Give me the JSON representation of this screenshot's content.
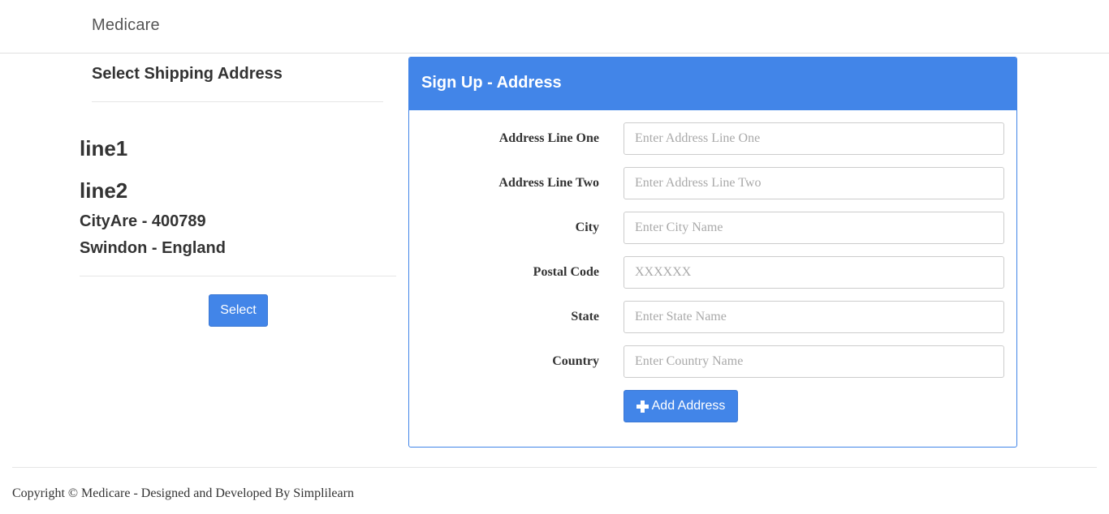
{
  "navbar": {
    "brand": "Medicare"
  },
  "shipping": {
    "heading": "Select Shipping Address",
    "address": {
      "line1": "line1",
      "line2": "line2",
      "city_postal": "CityAre - 400789",
      "state_country": "Swindon - England"
    },
    "select_label": "Select"
  },
  "form": {
    "title": "Sign Up - Address",
    "fields": [
      {
        "label": "Address Line One",
        "placeholder": "Enter Address Line One",
        "value": ""
      },
      {
        "label": "Address Line Two",
        "placeholder": "Enter Address Line Two",
        "value": ""
      },
      {
        "label": "City",
        "placeholder": "Enter City Name",
        "value": ""
      },
      {
        "label": "Postal Code",
        "placeholder": "XXXXXX",
        "value": ""
      },
      {
        "label": "State",
        "placeholder": "Enter State Name",
        "value": ""
      },
      {
        "label": "Country",
        "placeholder": "Enter Country Name",
        "value": ""
      }
    ],
    "submit_label": "Add Address",
    "submit_icon": "plus-icon"
  },
  "footer": {
    "text": "Copyright © Medicare - Designed and Developed By Simplilearn"
  },
  "colors": {
    "primary": "#4285e8",
    "text": "#333333",
    "divider": "#e6e6e6"
  }
}
